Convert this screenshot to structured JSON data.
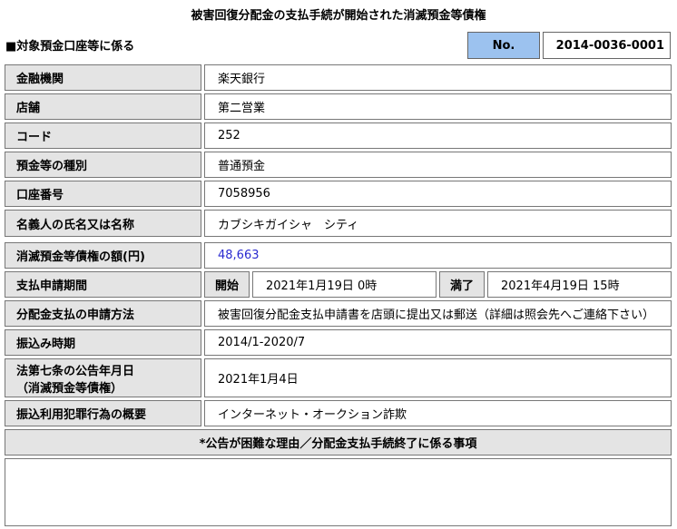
{
  "page_title": "被害回復分配金の支払手続が開始された消滅預金等債権",
  "section_heading": "■対象預金口座等に係る",
  "record_no": {
    "label": "No.",
    "value": "2014-0036-0001"
  },
  "rows": {
    "bank": {
      "label": "金融機関",
      "value": "楽天銀行"
    },
    "branch": {
      "label": "店舗",
      "value": "第二営業"
    },
    "code": {
      "label": "コード",
      "value": "252"
    },
    "deposit_type": {
      "label": "預金等の種別",
      "value": "普通預金"
    },
    "account_number": {
      "label": "口座番号",
      "value": "7058956"
    },
    "holder_name": {
      "label": "名義人の氏名又は名称",
      "value": "カブシキガイシャ　シティ"
    },
    "amount": {
      "label": "消滅預金等債権の額(円)",
      "value": "48,663"
    },
    "payment_period": {
      "label": "支払申請期間",
      "start_label": "開始",
      "start_value": "2021年1月19日 0時",
      "end_label": "満了",
      "end_value": "2021年4月19日 15時"
    },
    "application_method": {
      "label": "分配金支払の申請方法",
      "value": "被害回復分配金支払申請書を店頭に提出又は郵送（詳細は照会先へご連絡下さい）"
    },
    "transfer_period": {
      "label": "振込み時期",
      "value": "2014/1-2020/7"
    },
    "notice_date": {
      "label_line1": "法第七条の公告年月日",
      "label_line2": "（消滅預金等債権）",
      "value": "2021年1月4日"
    },
    "crime_summary": {
      "label": "振込利用犯罪行為の概要",
      "value": "インターネット・オークション詐欺"
    }
  },
  "footer_heading": "*公告が困難な理由／分配金支払手続終了に係る事項",
  "footer_content": ""
}
